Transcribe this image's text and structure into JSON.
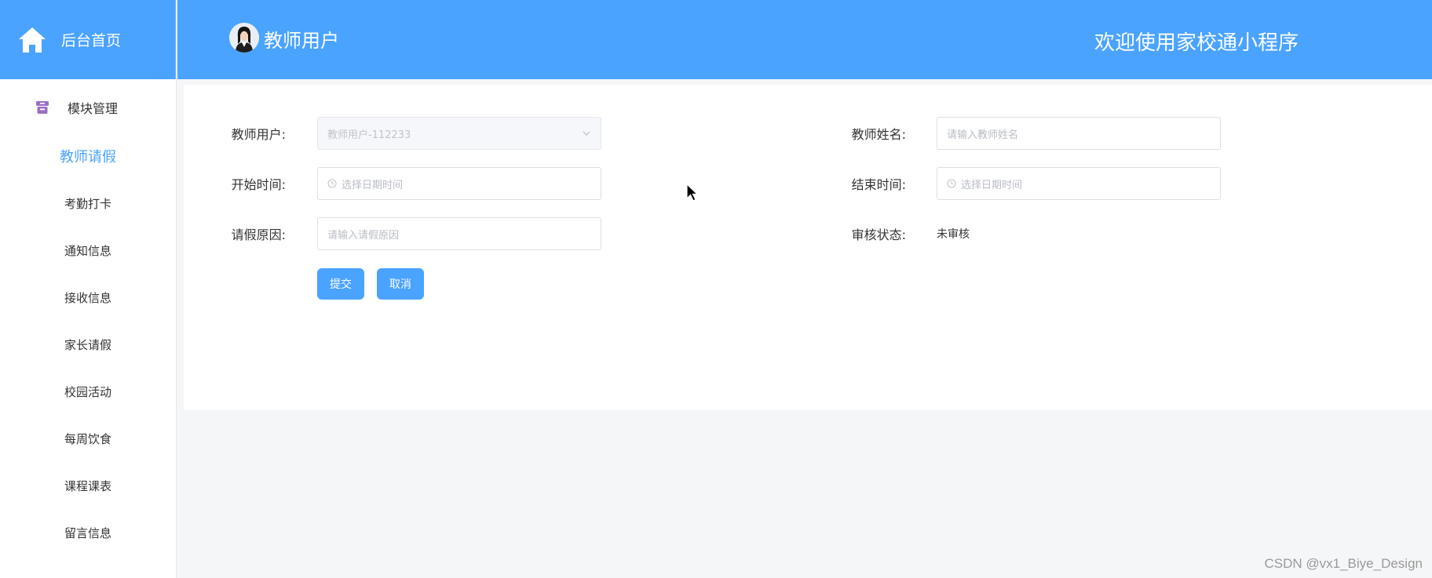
{
  "sidebar": {
    "home_label": "后台首页",
    "group_label": "模块管理",
    "items": [
      {
        "label": "教师请假",
        "active": true
      },
      {
        "label": "考勤打卡",
        "active": false
      },
      {
        "label": "通知信息",
        "active": false
      },
      {
        "label": "接收信息",
        "active": false
      },
      {
        "label": "家长请假",
        "active": false
      },
      {
        "label": "校园活动",
        "active": false
      },
      {
        "label": "每周饮食",
        "active": false
      },
      {
        "label": "课程课表",
        "active": false
      },
      {
        "label": "留言信息",
        "active": false
      }
    ]
  },
  "header": {
    "user_name": "教师用户",
    "welcome": "欢迎使用家校通小程序"
  },
  "form": {
    "teacher_user_label": "教师用户:",
    "teacher_user_value": "教师用户-112233",
    "teacher_name_label": "教师姓名:",
    "teacher_name_placeholder": "请输入教师姓名",
    "start_time_label": "开始时间:",
    "start_time_placeholder": "选择日期时间",
    "end_time_label": "结束时间:",
    "end_time_placeholder": "选择日期时间",
    "reason_label": "请假原因:",
    "reason_placeholder": "请输入请假原因",
    "status_label": "审核状态:",
    "status_value": "未审核",
    "submit_label": "提交",
    "cancel_label": "取消"
  },
  "watermark": "CSDN @vx1_Biye_Design",
  "colors": {
    "accent": "#4aa3ff",
    "group_icon": "#9b6fc4"
  }
}
